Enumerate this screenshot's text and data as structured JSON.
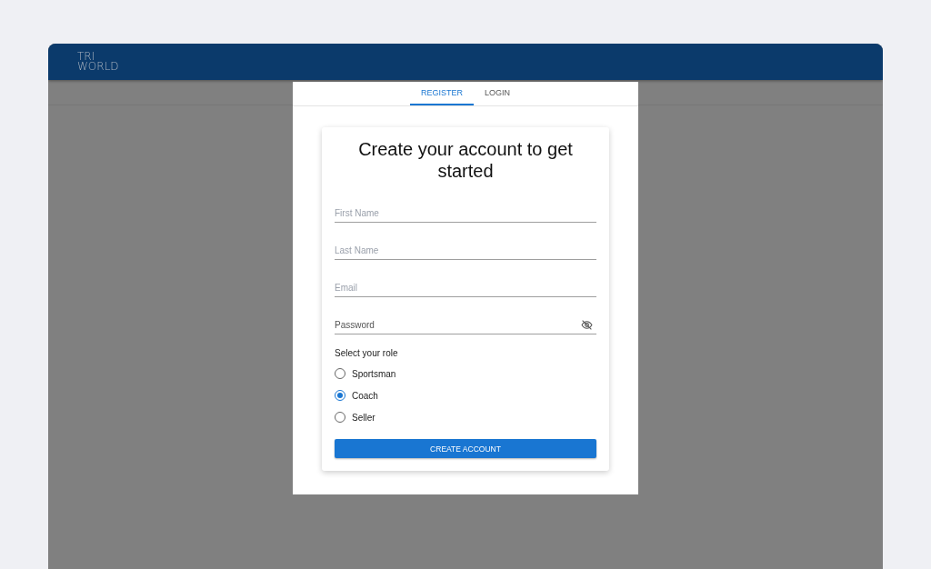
{
  "header": {
    "logo_top": "TRI",
    "logo_bottom": "WORLD"
  },
  "tabs": [
    {
      "label": "REGISTER",
      "selected": true
    },
    {
      "label": "LOGIN",
      "selected": false
    }
  ],
  "form": {
    "title": "Create your account to get started",
    "fields": [
      {
        "placeholder": "First Name",
        "kind": "text"
      },
      {
        "placeholder": "Last Name",
        "kind": "text"
      },
      {
        "placeholder": "Email",
        "kind": "text"
      },
      {
        "placeholder": "Password",
        "kind": "password"
      }
    ],
    "role_label": "Select your role",
    "roles": [
      {
        "label": "Sportsman",
        "selected": false
      },
      {
        "label": "Coach",
        "selected": true
      },
      {
        "label": "Seller",
        "selected": false
      }
    ],
    "submit": "CREATE ACCOUNT"
  }
}
